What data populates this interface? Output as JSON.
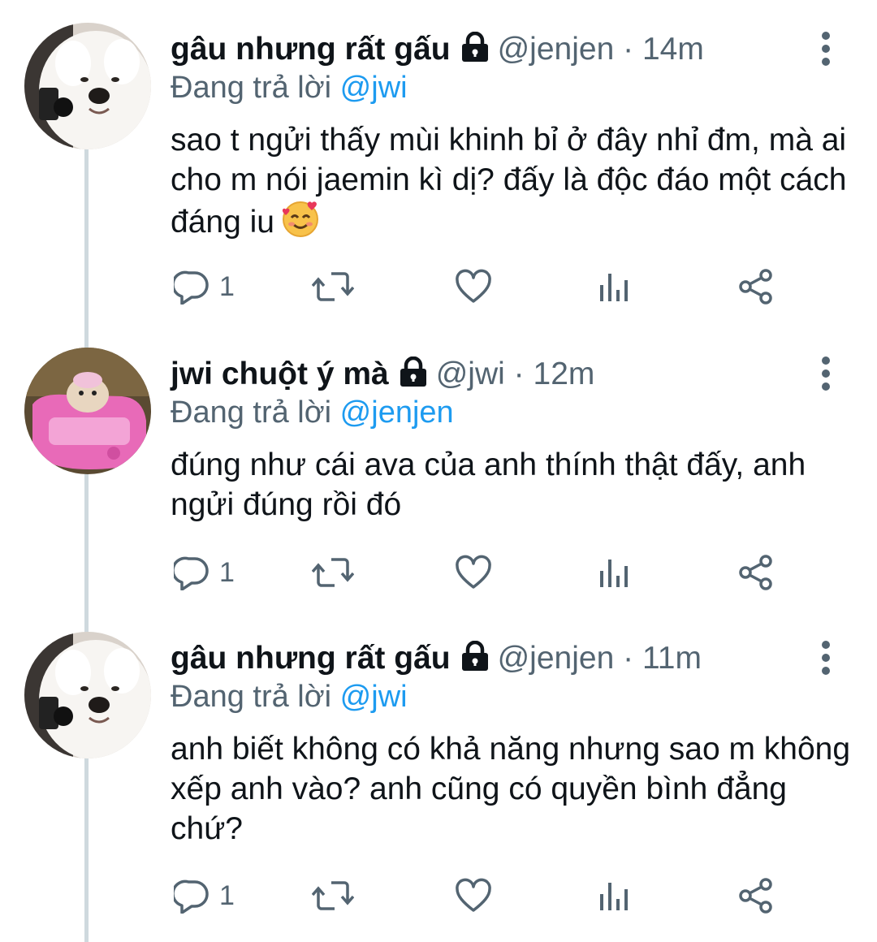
{
  "tweets": [
    {
      "display_name": "gâu nhưng rất gấu",
      "handle": "@jenjen",
      "separator": "·",
      "time": "14m",
      "replying_prefix": "Đang trả lời",
      "replying_to": "@jwi",
      "text": "sao t ngửi thấy mùi khinh bỉ ở đây nhỉ đm, mà ai cho m nói jaemin kì dị? đấy là độc đáo một cách đáng iu",
      "emoji": "smiling-face-with-hearts",
      "reply_count": "1",
      "avatar": "samoyed-dog"
    },
    {
      "display_name": "jwi chuột ý mà",
      "handle": "@jwi",
      "separator": "·",
      "time": "12m",
      "replying_prefix": "Đang trả lời",
      "replying_to": "@jenjen",
      "text": "đúng như cái ava của anh thính thật đấy, anh ngửi đúng rồi đó",
      "reply_count": "1",
      "avatar": "hamster-in-pink-toy-car"
    },
    {
      "display_name": "gâu nhưng rất gấu",
      "handle": "@jenjen",
      "separator": "·",
      "time": "11m",
      "replying_prefix": "Đang trả lời",
      "replying_to": "@jwi",
      "text": "anh biết không có khả năng nhưng sao m không xếp anh vào? anh cũng có quyền bình đẳng chứ?",
      "reply_count": "1",
      "avatar": "samoyed-dog"
    }
  ],
  "colors": {
    "text": "#0f1419",
    "secondary": "#536471",
    "link": "#1d9bf0",
    "thread_line": "#cfd9de"
  }
}
